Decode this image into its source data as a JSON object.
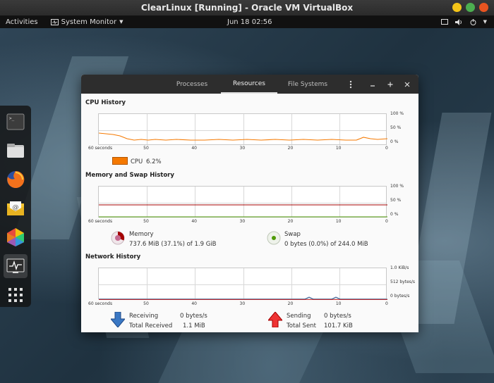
{
  "host": {
    "title": "ClearLinux [Running] - Oracle VM VirtualBox",
    "btn_colors": [
      "#f5c518",
      "#4caf50",
      "#e95420"
    ]
  },
  "topbar": {
    "activities": "Activities",
    "app_menu": "System Monitor",
    "clock": "Jun 18  02:56"
  },
  "dock": {
    "items": [
      "terminal-icon",
      "files-icon",
      "firefox-icon",
      "mail-icon",
      "software-icon",
      "system-monitor-icon",
      "app-grid-icon"
    ]
  },
  "window": {
    "tabs": [
      "Processes",
      "Resources",
      "File Systems"
    ],
    "active_tab": "Resources"
  },
  "cpu": {
    "title": "CPU History",
    "legend_label": "CPU",
    "legend_value": "6.2%",
    "color": "#f57900"
  },
  "memory": {
    "title": "Memory and Swap History",
    "memory_label": "Memory",
    "memory_value": "737.6 MiB (37.1%) of 1.9 GiB",
    "swap_label": "Swap",
    "swap_value": "0 bytes (0.0%) of 244.0 MiB",
    "memory_color": "#a40000",
    "swap_color": "#4e9a06"
  },
  "network": {
    "title": "Network History",
    "receiving_label": "Receiving",
    "receiving_rate": "0 bytes/s",
    "total_received_label": "Total Received",
    "total_received": "1.1 MiB",
    "sending_label": "Sending",
    "sending_rate": "0 bytes/s",
    "total_sent_label": "Total Sent",
    "total_sent": "101.7 KiB"
  },
  "axis": {
    "x_ticks": [
      "60 seconds",
      "50",
      "40",
      "30",
      "20",
      "10",
      "0"
    ],
    "y_ticks_pct": [
      "100 %",
      "50 %",
      "0 %"
    ],
    "y_ticks_net": [
      "1.0 KiB/s",
      "512 bytes/s",
      "0 bytes/s"
    ]
  }
}
